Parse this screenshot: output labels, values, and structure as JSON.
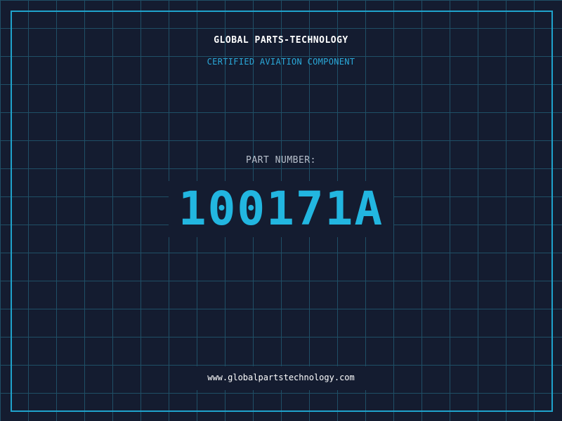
{
  "header": {
    "company": "GLOBAL PARTS-TECHNOLOGY",
    "subtitle": "CERTIFIED AVIATION COMPONENT"
  },
  "part": {
    "label": "PART NUMBER:",
    "number": "100171A"
  },
  "footer": {
    "website": "www.globalpartstechnology.com"
  },
  "colors": {
    "background": "#141c30",
    "grid": "#1f4f66",
    "accent": "#1fa3cc",
    "part_number": "#22b6e0"
  }
}
